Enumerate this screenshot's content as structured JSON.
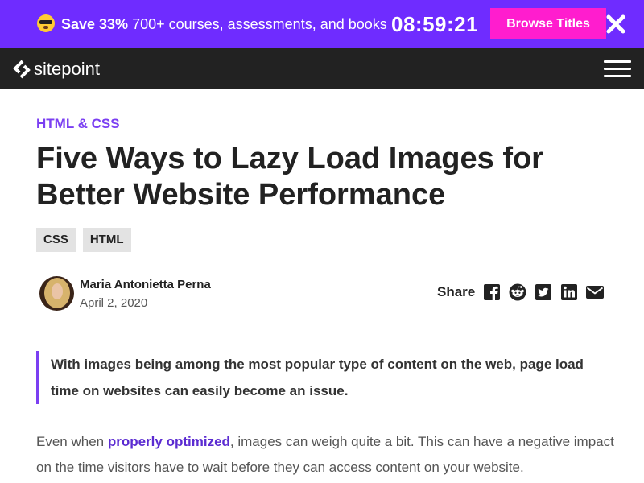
{
  "promo": {
    "emoji": "sunglasses-face-icon",
    "highlight": "Save 33%",
    "text": " 700+ courses, assessments, and books",
    "timer": "08:59:21",
    "button_label": "Browse Titles",
    "close_icon": "close-icon"
  },
  "header": {
    "logo_text": "sitepoint",
    "menu_icon": "hamburger-menu-icon"
  },
  "article": {
    "category": "HTML & CSS",
    "title": "Five Ways to Lazy Load Images for Better Website Performance",
    "tags": [
      "CSS",
      "HTML"
    ],
    "author": {
      "name": "Maria Antonietta Perna",
      "date": "April 2, 2020"
    },
    "share": {
      "label": "Share",
      "icons": [
        "facebook-icon",
        "reddit-icon",
        "twitter-icon",
        "linkedin-icon",
        "email-icon"
      ]
    },
    "intro": "With images being among the most popular type of content on the web, page load time on websites can easily become an issue.",
    "body": {
      "before_link": "Even when ",
      "link_text": "properly optimized",
      "after_link": ", images can weigh quite a bit. This can have a negative impact on the time visitors have to wait before they can access content on your website."
    }
  },
  "colors": {
    "promo_bg": "#6f2cff",
    "promo_button": "#ff1dce",
    "header_bg": "#222222",
    "accent": "#7b3ff2"
  }
}
